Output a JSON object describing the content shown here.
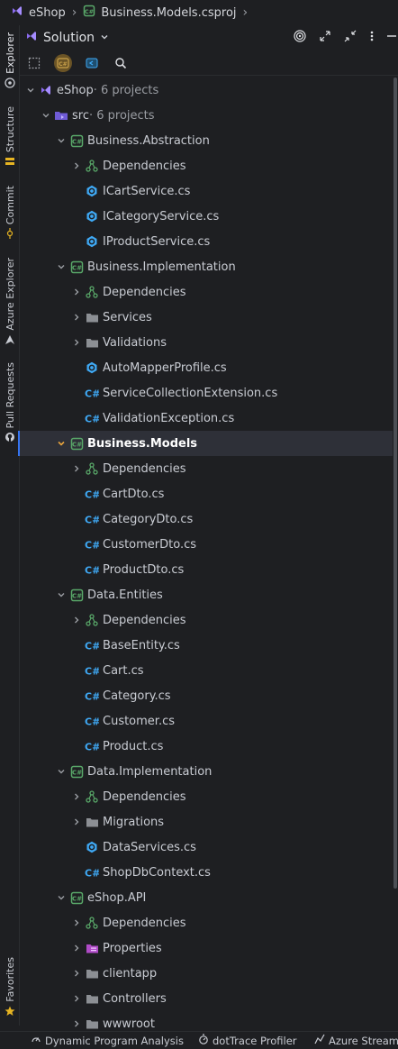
{
  "breadcrumb": {
    "items": [
      {
        "label": "eShop",
        "icon": "solution-icon"
      },
      {
        "label": "Business.Models.csproj",
        "icon": "csproj-icon"
      }
    ]
  },
  "sidebar_tabs": [
    {
      "label": "Explorer",
      "icon": "explorer-icon",
      "active": true
    },
    {
      "label": "Structure",
      "icon": "structure-icon"
    },
    {
      "label": "Commit",
      "icon": "commit-icon"
    },
    {
      "label": "Azure Explorer",
      "icon": "azure-icon"
    },
    {
      "label": "Pull Requests",
      "icon": "github-icon"
    },
    {
      "label": "Favorites",
      "icon": "star-icon"
    }
  ],
  "panel": {
    "title": "Solution",
    "header_icons": [
      "target-icon",
      "expand-icon",
      "collapse-icon",
      "more-icon",
      "minimize-icon"
    ],
    "toolbar_icons": [
      "select-icon",
      "csharp-filter-icon",
      "file-icon",
      "search-icon"
    ]
  },
  "tree": [
    {
      "depth": 0,
      "expand": "open",
      "icon": "solution-icon",
      "label": "eShop",
      "meta": " · 6 projects"
    },
    {
      "depth": 1,
      "expand": "open",
      "icon": "folder-solution-icon",
      "label": "src",
      "meta": " · 6 projects"
    },
    {
      "depth": 2,
      "expand": "open",
      "icon": "csproj-icon",
      "label": "Business.Abstraction"
    },
    {
      "depth": 3,
      "expand": "closed",
      "icon": "dependencies-icon",
      "label": "Dependencies"
    },
    {
      "depth": 3,
      "expand": "none",
      "icon": "interface-icon",
      "label": "ICartService.cs"
    },
    {
      "depth": 3,
      "expand": "none",
      "icon": "interface-icon",
      "label": "ICategoryService.cs"
    },
    {
      "depth": 3,
      "expand": "none",
      "icon": "interface-icon",
      "label": "IProductService.cs"
    },
    {
      "depth": 2,
      "expand": "open",
      "icon": "csproj-icon",
      "label": "Business.Implementation"
    },
    {
      "depth": 3,
      "expand": "closed",
      "icon": "dependencies-icon",
      "label": "Dependencies"
    },
    {
      "depth": 3,
      "expand": "closed",
      "icon": "folder-icon",
      "label": "Services"
    },
    {
      "depth": 3,
      "expand": "closed",
      "icon": "folder-icon",
      "label": "Validations"
    },
    {
      "depth": 3,
      "expand": "none",
      "icon": "interface-icon",
      "label": "AutoMapperProfile.cs"
    },
    {
      "depth": 3,
      "expand": "none",
      "icon": "csharp-icon",
      "label": "ServiceCollectionExtension.cs"
    },
    {
      "depth": 3,
      "expand": "none",
      "icon": "csharp-icon",
      "label": "ValidationException.cs"
    },
    {
      "depth": 2,
      "expand": "open",
      "icon": "csproj-icon",
      "label": "Business.Models",
      "selected": true
    },
    {
      "depth": 3,
      "expand": "closed",
      "icon": "dependencies-icon",
      "label": "Dependencies"
    },
    {
      "depth": 3,
      "expand": "none",
      "icon": "csharp-icon",
      "label": "CartDto.cs"
    },
    {
      "depth": 3,
      "expand": "none",
      "icon": "csharp-icon",
      "label": "CategoryDto.cs"
    },
    {
      "depth": 3,
      "expand": "none",
      "icon": "csharp-icon",
      "label": "CustomerDto.cs"
    },
    {
      "depth": 3,
      "expand": "none",
      "icon": "csharp-icon",
      "label": "ProductDto.cs"
    },
    {
      "depth": 2,
      "expand": "open",
      "icon": "csproj-icon",
      "label": "Data.Entities"
    },
    {
      "depth": 3,
      "expand": "closed",
      "icon": "dependencies-icon",
      "label": "Dependencies"
    },
    {
      "depth": 3,
      "expand": "none",
      "icon": "csharp-icon",
      "label": "BaseEntity.cs"
    },
    {
      "depth": 3,
      "expand": "none",
      "icon": "csharp-icon",
      "label": "Cart.cs"
    },
    {
      "depth": 3,
      "expand": "none",
      "icon": "csharp-icon",
      "label": "Category.cs"
    },
    {
      "depth": 3,
      "expand": "none",
      "icon": "csharp-icon",
      "label": "Customer.cs"
    },
    {
      "depth": 3,
      "expand": "none",
      "icon": "csharp-icon",
      "label": "Product.cs"
    },
    {
      "depth": 2,
      "expand": "open",
      "icon": "csproj-icon",
      "label": "Data.Implementation"
    },
    {
      "depth": 3,
      "expand": "closed",
      "icon": "dependencies-icon",
      "label": "Dependencies"
    },
    {
      "depth": 3,
      "expand": "closed",
      "icon": "folder-icon",
      "label": "Migrations"
    },
    {
      "depth": 3,
      "expand": "none",
      "icon": "interface-icon",
      "label": "DataServices.cs"
    },
    {
      "depth": 3,
      "expand": "none",
      "icon": "csharp-icon",
      "label": "ShopDbContext.cs"
    },
    {
      "depth": 2,
      "expand": "open",
      "icon": "csproj-icon",
      "label": "eShop.API"
    },
    {
      "depth": 3,
      "expand": "closed",
      "icon": "dependencies-icon",
      "label": "Dependencies"
    },
    {
      "depth": 3,
      "expand": "closed",
      "icon": "properties-folder-icon",
      "label": "Properties"
    },
    {
      "depth": 3,
      "expand": "closed",
      "icon": "folder-icon",
      "label": "clientapp"
    },
    {
      "depth": 3,
      "expand": "closed",
      "icon": "folder-icon",
      "label": "Controllers"
    },
    {
      "depth": 3,
      "expand": "closed",
      "icon": "folder-icon",
      "label": "wwwroot"
    }
  ],
  "statusbar": {
    "items": [
      {
        "label": "Dynamic Program Analysis",
        "icon": "dpa-icon"
      },
      {
        "label": "dotTrace Profiler",
        "icon": "profiler-icon"
      },
      {
        "label": "Azure Streamin",
        "icon": "azure-stream-icon"
      }
    ]
  },
  "colors": {
    "background": "#1e1f22",
    "accent": "#3574f0",
    "solution_purple": "#8c6cf0",
    "csharp_blue": "#3fa9f5",
    "csproj_green": "#59a869",
    "folder_gray": "#8c8f94",
    "selection_orange": "#e8a33d"
  }
}
